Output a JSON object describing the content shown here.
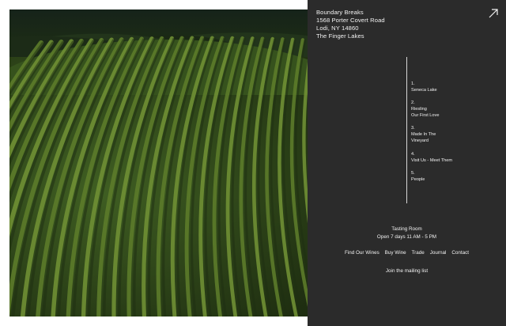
{
  "photo": {
    "alt": "Aerial view of vineyard rows"
  },
  "address": {
    "lines": [
      "Boundary Breaks",
      "1568 Porter Covert Road",
      "Lodi, NY 14860",
      "The Finger Lakes"
    ]
  },
  "corner_icon": "arrow-up-right-icon",
  "menu": [
    {
      "number": "1.",
      "lines": [
        "Seneca Lake"
      ]
    },
    {
      "number": "2.",
      "lines": [
        "Riesling",
        "Our First Love"
      ]
    },
    {
      "number": "3.",
      "lines": [
        "Made In The",
        "Vineyard"
      ]
    },
    {
      "number": "4.",
      "lines": [
        "Visit Us - Meet Them"
      ]
    },
    {
      "number": "5.",
      "lines": [
        "People"
      ]
    }
  ],
  "tasting": {
    "title": "Tasting Room",
    "hours": "Open 7 days 11 AM - 5 PM"
  },
  "nav": [
    "Find Our Wines",
    "Buy Wine",
    "Trade",
    "Journal",
    "Contact"
  ],
  "mailing_label": "Join the mailing list",
  "colors": {
    "panel_bg": "#2b2b2b",
    "text": "#f2f2f2",
    "page_bg": "#ffffff"
  }
}
